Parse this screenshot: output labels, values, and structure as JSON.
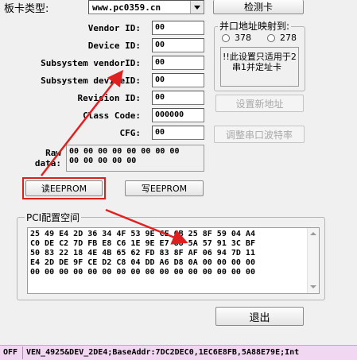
{
  "board": {
    "label": "板卡类型:",
    "value": "www.pc0359.cn",
    "detect_button": "检测卡"
  },
  "fields": [
    {
      "label": "Vendor ID:",
      "value": "00"
    },
    {
      "label": "Device ID:",
      "value": "00"
    },
    {
      "label": "Subsystem vendorID:",
      "value": "00"
    },
    {
      "label": "Subsystem deviceID:",
      "value": "00"
    },
    {
      "label": "Revision ID:",
      "value": "00"
    },
    {
      "label": "Class Code:",
      "value": "000000"
    },
    {
      "label": "CFG:",
      "value": "00"
    }
  ],
  "raw": {
    "label_line1": "Raw",
    "label_line2": "data:",
    "line1": "00 00 00 00 00 00 00 00",
    "line2": "00 00 00 00 00"
  },
  "mapping": {
    "title": "并口地址映射到:",
    "option1": "378",
    "option2": "278",
    "note_line1": "!!此设置只适用于2",
    "note_line2": "串1并定址卡",
    "set_address_button": "设置新地址",
    "baud_button": "调整串口波特率"
  },
  "buttons": {
    "read_eeprom": "读EEPROM",
    "write_eeprom": "写EEPROM",
    "exit": "退出"
  },
  "pci": {
    "title": "PCI配置空间",
    "rows": [
      "25 49 E4 2D 36 34 4F 53 9E CE 6B 25 8F 59 04 A4",
      "C0 DE C2 7D FB E8 C6 1E 9E E7 88 5A 57 91 3C BF",
      "50 83 22 18 4E 4B 65 62 FD 83 8F AF 06 94 7D 11",
      "E4 2D DE 9F CE D2 C8 04 DD A6 D8 0A 00 00 00 00",
      "00 00 00 00 00 00 00 00 00 00 00 00 00 00 00 00"
    ]
  },
  "status_bar": {
    "state": "OFF",
    "text": "VEN_4925&DEV_2DE4;BaseAddr:7DC2DEC0,1EC6E8FB,5A88E79E;Int"
  },
  "colors": {
    "highlight": "#d9221c",
    "arrow": "#e02020",
    "status_bg": "#f2d7f2",
    "note_text": "#000000"
  }
}
